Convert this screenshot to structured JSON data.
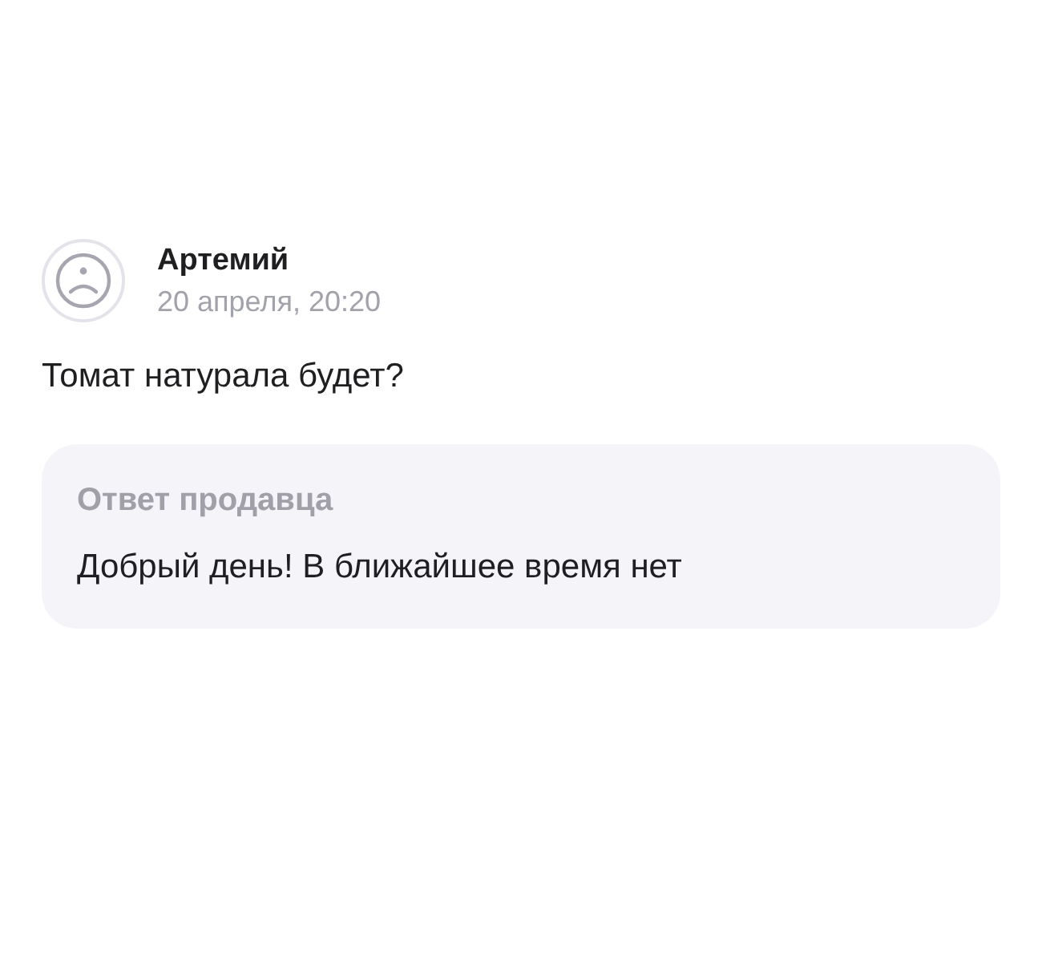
{
  "review": {
    "author": "Артемий",
    "date": "20 апреля, 20:20",
    "text": "Томат натурала будет?"
  },
  "reply": {
    "title": "Ответ продавца",
    "text": "Добрый день! В ближайшее время нет"
  }
}
